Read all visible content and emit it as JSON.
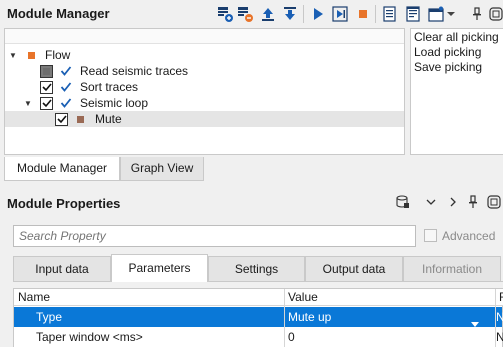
{
  "module_manager": {
    "title": "Module Manager",
    "toolbar_icons": [
      "add-module-icon",
      "remove-module-icon",
      "move-up-icon",
      "move-down-icon",
      "run-icon",
      "step-run-icon",
      "stop-icon",
      "notes-icon",
      "log-icon",
      "window-icon",
      "dropdown-icon"
    ],
    "tree": [
      {
        "label": "Flow",
        "level": 0,
        "expanded": true,
        "marker": "orange-square"
      },
      {
        "label": "Read seismic traces",
        "level": 1,
        "checkbox": "partial",
        "checked": true
      },
      {
        "label": "Sort traces",
        "level": 1,
        "checkbox": "checked",
        "checked": true
      },
      {
        "label": "Seismic loop",
        "level": 1,
        "checkbox": "checked",
        "checked": true,
        "expanded": true
      },
      {
        "label": "Mute",
        "level": 2,
        "checkbox": "checked",
        "marker": "brown-square",
        "selected": true
      }
    ],
    "side_actions": [
      "Clear all picking",
      "Load picking",
      "Save picking"
    ],
    "tabs": [
      {
        "label": "Module Manager",
        "active": true
      },
      {
        "label": "Graph View",
        "active": false
      }
    ]
  },
  "module_properties": {
    "title": "Module Properties",
    "search_placeholder": "Search Property",
    "advanced_label": "Advanced",
    "tabs": [
      {
        "label": "Input data",
        "active": false
      },
      {
        "label": "Parameters",
        "active": true
      },
      {
        "label": "Settings",
        "active": false
      },
      {
        "label": "Output data",
        "active": false
      },
      {
        "label": "Information",
        "active": false,
        "disabled": true
      }
    ],
    "grid": {
      "columns": [
        "Name",
        "Value",
        "R"
      ],
      "rows": [
        {
          "name": "Type",
          "value": "Mute up",
          "extra": "N",
          "selected": true
        },
        {
          "name": "Taper window <ms>",
          "value": "0",
          "extra": "N",
          "selected": false
        }
      ]
    }
  },
  "colors": {
    "selection_blue": "#0a78d7",
    "check_blue": "#1a5fb4",
    "flow_marker": "#e8742a",
    "mute_marker": "#9a6a55"
  }
}
